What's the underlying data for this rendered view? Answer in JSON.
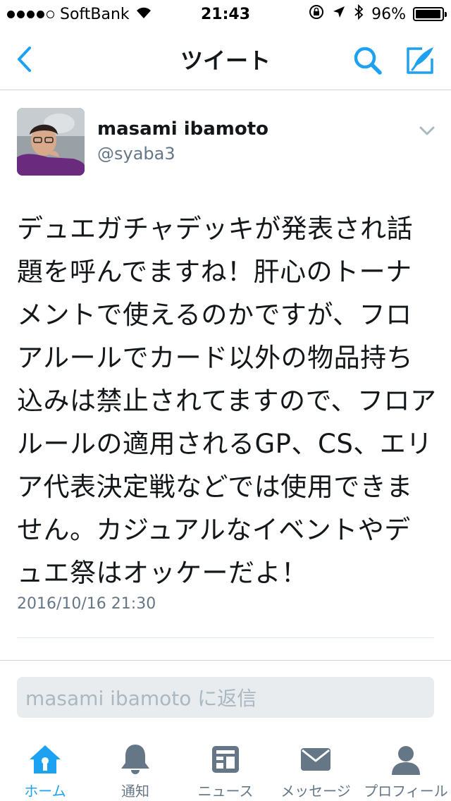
{
  "status_bar": {
    "carrier": "SoftBank",
    "time": "21:43",
    "battery": "96%",
    "battery_level": 0.96
  },
  "nav": {
    "title": "ツイート"
  },
  "tweet": {
    "author_name": "masami ibamoto",
    "author_handle": "@syaba3",
    "text": "デュエガチャデッキが発表され話題を呼んでますね！肝心のトーナメントで使えるのかですが、フロアルールでカード以外の物品持ち込みは禁止されてますので、フロアルールの適用されるGP、CS、エリア代表決定戦などでは使用できません。カジュアルなイベントやデュエ祭はオッケーだよ！",
    "timestamp": "2016/10/16 21:30"
  },
  "reply": {
    "placeholder": "masami ibamoto に返信"
  },
  "tabs": [
    {
      "label": "ホーム",
      "icon": "home-icon",
      "active": true
    },
    {
      "label": "通知",
      "icon": "bell-icon",
      "active": false
    },
    {
      "label": "ニュース",
      "icon": "news-icon",
      "active": false
    },
    {
      "label": "メッセージ",
      "icon": "envelope-icon",
      "active": false
    },
    {
      "label": "プロフィール",
      "icon": "person-icon",
      "active": false
    }
  ],
  "colors": {
    "accent": "#1da1f2",
    "inactive_icon": "#657786",
    "text": "#14171a",
    "secondary_text": "#657786"
  }
}
